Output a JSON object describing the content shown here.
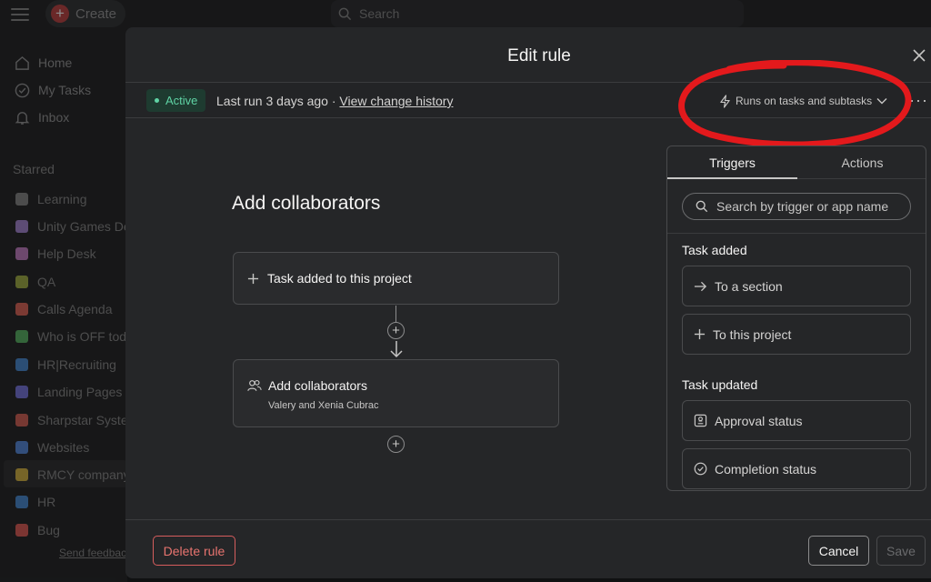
{
  "topbar": {
    "create_label": "Create",
    "search_placeholder": "Search"
  },
  "sidebar": {
    "nav": [
      {
        "label": "Home",
        "icon": "home-icon"
      },
      {
        "label": "My Tasks",
        "icon": "check-circle-icon"
      },
      {
        "label": "Inbox",
        "icon": "bell-icon"
      }
    ],
    "section_title": "Starred",
    "projects": [
      {
        "label": "Learning",
        "color": "#8a8a8a"
      },
      {
        "label": "Unity Games De",
        "color": "#a98bd6"
      },
      {
        "label": "Help Desk",
        "color": "#c783c7"
      },
      {
        "label": "QA",
        "color": "#a6b34b"
      },
      {
        "label": "Calls Agenda",
        "color": "#e06a5e"
      },
      {
        "label": "Who is OFF toda",
        "color": "#5fb86a"
      },
      {
        "label": "HR|Recruiting",
        "color": "#4f8fd6"
      },
      {
        "label": "Landing Pages",
        "color": "#7d7ae0"
      },
      {
        "label": "Sharpstar Syste",
        "color": "#d8675c"
      },
      {
        "label": "Websites",
        "color": "#5b8fe0"
      },
      {
        "label": "RMCY company",
        "color": "#d9b84a"
      },
      {
        "label": "HR",
        "color": "#4f8fd6"
      },
      {
        "label": "Bug",
        "color": "#e0615c"
      }
    ],
    "send_feedback": "Send feedback"
  },
  "modal": {
    "title": "Edit rule",
    "status": "Active",
    "last_run": "Last run 3 days ago · ",
    "change_history": "View change history",
    "runs_on": "Runs on tasks and subtasks",
    "rule_title": "Add collaborators",
    "trigger_card": "Task added to this project",
    "action_card_title": "Add collaborators",
    "action_card_sub": "Valery and Xenia Cubrac",
    "delete_label": "Delete rule",
    "cancel_label": "Cancel",
    "save_label": "Save"
  },
  "panel": {
    "tabs": [
      "Triggers",
      "Actions"
    ],
    "search_placeholder": "Search by trigger or app name",
    "groups": [
      {
        "title": "Task added",
        "options": [
          {
            "label": "To a section",
            "icon": "arrow-right-icon"
          },
          {
            "label": "To this project",
            "icon": "plus-icon"
          }
        ]
      },
      {
        "title": "Task updated",
        "options": [
          {
            "label": "Approval status",
            "icon": "approval-icon"
          },
          {
            "label": "Completion status",
            "icon": "check-circle-icon"
          }
        ]
      }
    ]
  },
  "colors": {
    "accent_green": "#5fd3a4",
    "danger": "#e8746f",
    "annotation_red": "#e3191c"
  }
}
